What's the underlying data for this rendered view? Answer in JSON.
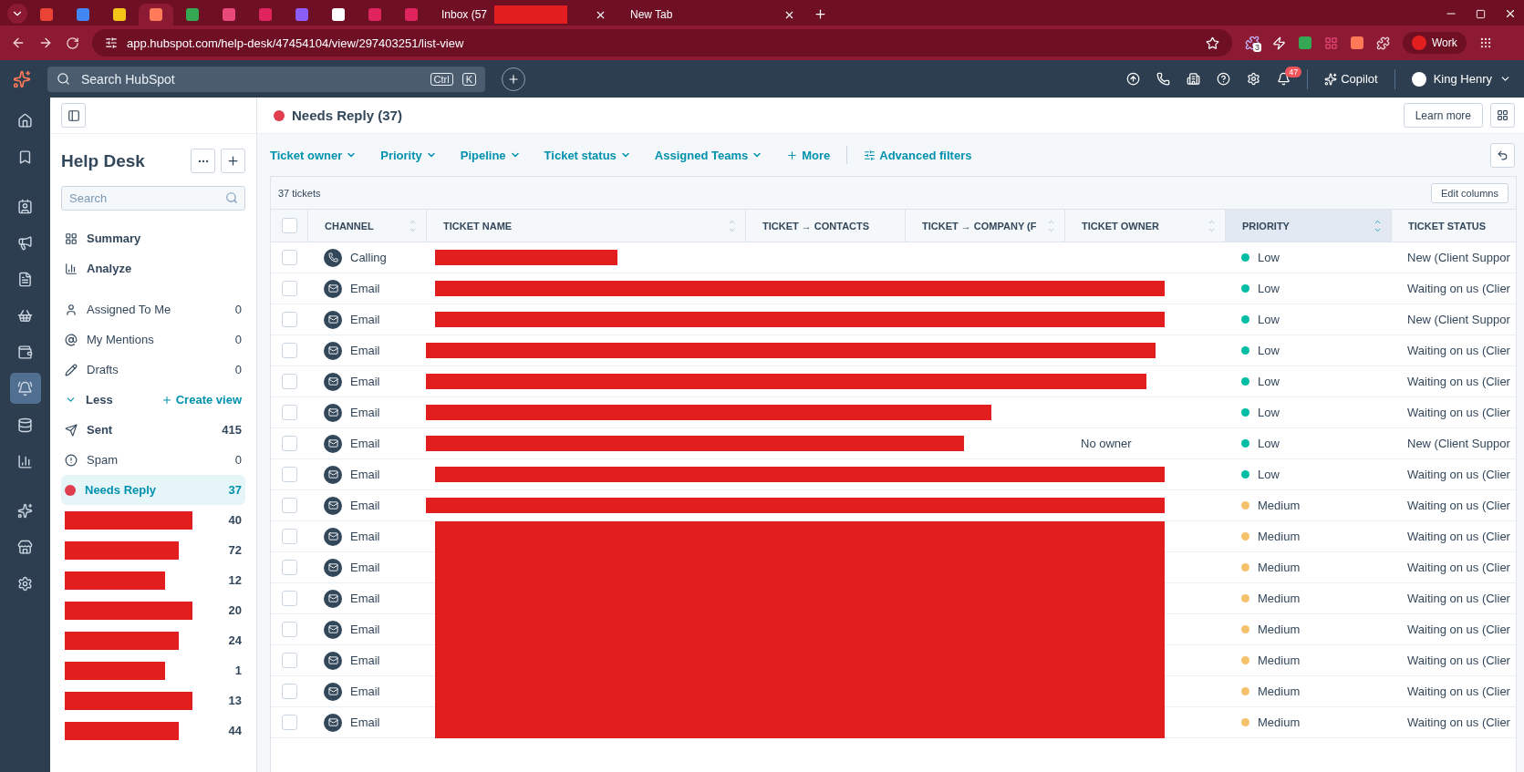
{
  "browser": {
    "tabs": [
      {
        "kind": "favicon",
        "color": "#ea4335",
        "selected": false
      },
      {
        "kind": "favicon",
        "color": "#4285f4",
        "selected": false
      },
      {
        "kind": "favicon",
        "color": "#f5c518",
        "selected": false
      },
      {
        "kind": "favicon",
        "color": "#ff7a59",
        "selected": true
      },
      {
        "kind": "favicon",
        "color": "#34a853",
        "selected": false
      },
      {
        "kind": "favicon",
        "color": "#e8487a",
        "selected": false
      },
      {
        "kind": "favicon",
        "color": "#e0245e",
        "selected": false
      },
      {
        "kind": "favicon",
        "color": "#8b5cf6",
        "selected": false
      },
      {
        "kind": "favicon",
        "color": "#ffffff",
        "selected": false
      },
      {
        "kind": "favicon",
        "color": "#e0245e",
        "selected": false
      },
      {
        "kind": "favicon",
        "color": "#e0245e",
        "selected": false
      },
      {
        "kind": "labeled",
        "label": "Inbox (57",
        "redacted": true,
        "selected": false
      },
      {
        "kind": "labeled",
        "label": "New Tab",
        "redacted": false,
        "selected": false
      }
    ],
    "url": "app.hubspot.com/help-desk/47454104/view/297403251/list-view",
    "extension_badge": "3",
    "profile": "Work"
  },
  "top_nav": {
    "search_placeholder": "Search HubSpot",
    "shortcut": [
      "Ctrl",
      "K"
    ],
    "notifications": "47",
    "copilot": "Copilot",
    "user": "King Henry"
  },
  "nav_rail": {
    "items": [
      {
        "selected": false
      },
      {
        "selected": false
      },
      {
        "selected": false
      },
      {
        "selected": false
      },
      {
        "selected": false
      },
      {
        "selected": false
      },
      {
        "selected": false
      },
      {
        "selected": true
      },
      {
        "selected": false
      },
      {
        "selected": false
      },
      {
        "selected": false
      },
      {
        "selected": false
      },
      {
        "selected": false
      }
    ]
  },
  "sidebar": {
    "title": "Help Desk",
    "search_placeholder": "Search",
    "sections": [
      {
        "label": "Summary"
      },
      {
        "label": "Analyze"
      }
    ],
    "inbox": [
      {
        "label": "Assigned To Me",
        "count": "0"
      },
      {
        "label": "My Mentions",
        "count": "0"
      },
      {
        "label": "Drafts",
        "count": "0"
      }
    ],
    "toggle": "Less",
    "create_view": "Create view",
    "views": [
      {
        "kind": "named",
        "label": "Sent",
        "count": "415",
        "selected": false
      },
      {
        "kind": "named",
        "label": "Spam",
        "count": "0",
        "selected": false
      },
      {
        "kind": "named",
        "label": "Needs Reply",
        "count": "37",
        "selected": true
      },
      {
        "kind": "redacted",
        "count": "40",
        "selected": false
      },
      {
        "kind": "redacted",
        "count": "72",
        "selected": false
      },
      {
        "kind": "redacted",
        "count": "12",
        "selected": false
      },
      {
        "kind": "redacted",
        "count": "20",
        "selected": false
      },
      {
        "kind": "redacted",
        "count": "24",
        "selected": false
      },
      {
        "kind": "redacted",
        "count": "1",
        "selected": false
      },
      {
        "kind": "redacted",
        "count": "13",
        "selected": false
      },
      {
        "kind": "redacted",
        "count": "44",
        "selected": false
      }
    ]
  },
  "header": {
    "title": "Needs Reply (37)",
    "learn_more": "Learn more"
  },
  "filters": {
    "items": [
      "Ticket owner",
      "Priority",
      "Pipeline",
      "Ticket status",
      "Assigned Teams"
    ],
    "more": "More",
    "advanced": "Advanced filters"
  },
  "table": {
    "count": "37 tickets",
    "edit_columns": "Edit columns",
    "all_checked": false,
    "columns": [
      {
        "label": "CHANNEL",
        "sortable": true,
        "sorted": false
      },
      {
        "label": "TICKET NAME",
        "sortable": true,
        "sorted": false
      },
      {
        "label": "TICKET → CONTACTS",
        "sortable": false
      },
      {
        "label": "TICKET → COMPANY (F",
        "sortable": true,
        "sorted": false
      },
      {
        "label": "TICKET OWNER",
        "sortable": true,
        "sorted": false
      },
      {
        "label": "PRIORITY",
        "sortable": true,
        "sorted": true
      },
      {
        "label": "TICKET STATUS",
        "sortable": false
      }
    ],
    "rows": [
      {
        "channel": "Calling",
        "kind": "call",
        "checked": false,
        "priority": "Low",
        "color": "#00bda5",
        "status": "New (Client Suppor"
      },
      {
        "channel": "Email",
        "kind": "email",
        "checked": false,
        "priority": "Low",
        "color": "#00bda5",
        "status": "Waiting on us (Clier"
      },
      {
        "channel": "Email",
        "kind": "email",
        "checked": false,
        "priority": "Low",
        "color": "#00bda5",
        "status": "New (Client Suppor"
      },
      {
        "channel": "Email",
        "kind": "email",
        "checked": false,
        "priority": "Low",
        "color": "#00bda5",
        "status": "Waiting on us (Clier"
      },
      {
        "channel": "Email",
        "kind": "email",
        "checked": false,
        "priority": "Low",
        "color": "#00bda5",
        "status": "Waiting on us (Clier"
      },
      {
        "channel": "Email",
        "kind": "email",
        "checked": false,
        "priority": "Low",
        "color": "#00bda5",
        "status": "Waiting on us (Clier"
      },
      {
        "channel": "Email",
        "kind": "email",
        "checked": false,
        "owner": "No owner",
        "priority": "Low",
        "color": "#00bda5",
        "status": "New (Client Suppor"
      },
      {
        "channel": "Email",
        "kind": "email",
        "checked": false,
        "priority": "Low",
        "color": "#00bda5",
        "status": "Waiting on us (Clier"
      },
      {
        "channel": "Email",
        "kind": "email",
        "checked": false,
        "priority": "Medium",
        "color": "#f5c26b",
        "status": "Waiting on us (Clier"
      },
      {
        "channel": "Email",
        "kind": "email",
        "checked": false,
        "priority": "Medium",
        "color": "#f5c26b",
        "status": "Waiting on us (Clier"
      },
      {
        "channel": "Email",
        "kind": "email",
        "checked": false,
        "priority": "Medium",
        "color": "#f5c26b",
        "status": "Waiting on us (Clier"
      },
      {
        "channel": "Email",
        "kind": "email",
        "checked": false,
        "priority": "Medium",
        "color": "#f5c26b",
        "status": "Waiting on us (Clier"
      },
      {
        "channel": "Email",
        "kind": "email",
        "checked": false,
        "priority": "Medium",
        "color": "#f5c26b",
        "status": "Waiting on us (Clier"
      },
      {
        "channel": "Email",
        "kind": "email",
        "checked": false,
        "priority": "Medium",
        "color": "#f5c26b",
        "status": "Waiting on us (Clier"
      },
      {
        "channel": "Email",
        "kind": "email",
        "checked": false,
        "priority": "Medium",
        "color": "#f5c26b",
        "status": "Waiting on us (Clier"
      },
      {
        "channel": "Email",
        "kind": "email",
        "checked": false,
        "priority": "Medium",
        "color": "#f5c26b",
        "status": "Waiting on us (Clier"
      }
    ]
  }
}
